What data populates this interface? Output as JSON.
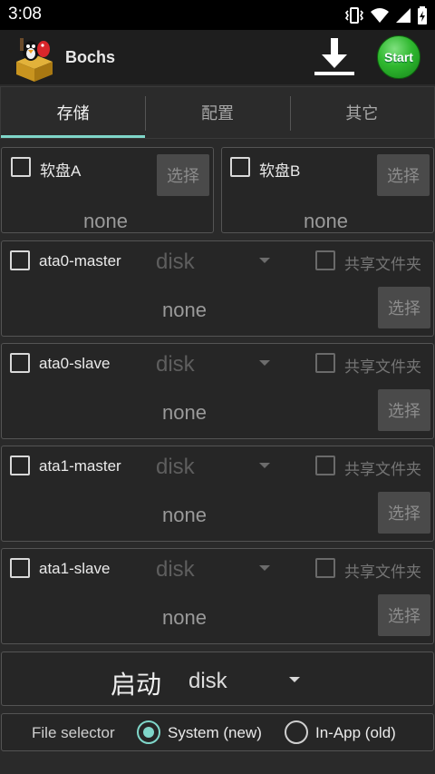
{
  "status": {
    "time": "3:08"
  },
  "app": {
    "title": "Bochs",
    "start_label": "Start"
  },
  "tabs": [
    {
      "label": "存储",
      "active": true
    },
    {
      "label": "配置",
      "active": false
    },
    {
      "label": "其它",
      "active": false
    }
  ],
  "floppies": [
    {
      "label": "软盘A",
      "value": "none",
      "select_label": "选择",
      "checked": false
    },
    {
      "label": "软盘B",
      "value": "none",
      "select_label": "选择",
      "checked": false
    }
  ],
  "drives": [
    {
      "label": "ata0-master",
      "type": "disk",
      "share_label": "共享文件夹",
      "value": "none",
      "select_label": "选择",
      "checked": false
    },
    {
      "label": "ata0-slave",
      "type": "disk",
      "share_label": "共享文件夹",
      "value": "none",
      "select_label": "选择",
      "checked": false
    },
    {
      "label": "ata1-master",
      "type": "disk",
      "share_label": "共享文件夹",
      "value": "none",
      "select_label": "选择",
      "checked": false
    },
    {
      "label": "ata1-slave",
      "type": "disk",
      "share_label": "共享文件夹",
      "value": "none",
      "select_label": "选择",
      "checked": false
    }
  ],
  "boot": {
    "label": "启动",
    "value": "disk"
  },
  "file_selector": {
    "label": "File selector",
    "options": [
      {
        "label": "System (new)",
        "selected": true
      },
      {
        "label": "In-App (old)",
        "selected": false
      }
    ]
  },
  "colors": {
    "accent": "#7fd6c9",
    "start_green": "#2fb82f"
  }
}
